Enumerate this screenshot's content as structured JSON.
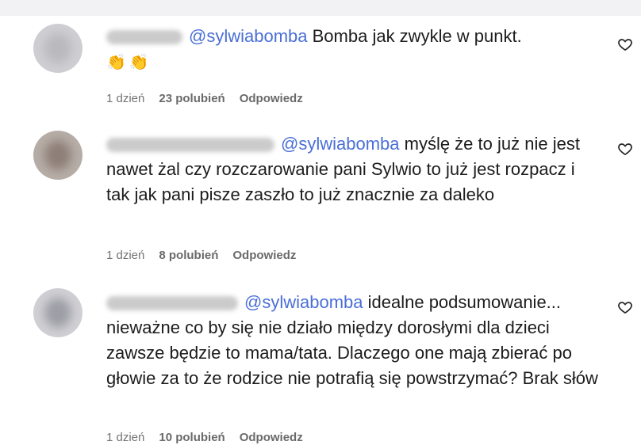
{
  "comments": [
    {
      "username": "user",
      "mention": "@sylwiabomba",
      "text": "Bomba jak zwykle w punkt.",
      "emoji": "👏👏",
      "time": "1 dzień",
      "likes": "23 polubień",
      "reply": "Odpowiedz"
    },
    {
      "username": "user",
      "mention": "@sylwiabomba",
      "text": "myślę że to już nie jest nawet żal czy rozczarowanie pani Sylwio to już jest rozpacz i tak jak pani pisze zaszło to już znacznie za daleko",
      "time": "1 dzień",
      "likes": "8 polubień",
      "reply": "Odpowiedz"
    },
    {
      "username": "user",
      "mention": "@sylwiabomba",
      "text": "idealne podsumowanie... nieważne co by się nie działo między dorosłymi dla dzieci zawsze będzie to mama/tata. Dlaczego one mają zbierać po głowie za to że rodzice nie potrafią się powstrzymać? Brak słów",
      "time": "1 dzień",
      "likes": "10 polubień",
      "reply": "Odpowiedz"
    }
  ],
  "icons": {
    "like": "heart-outline-icon"
  }
}
